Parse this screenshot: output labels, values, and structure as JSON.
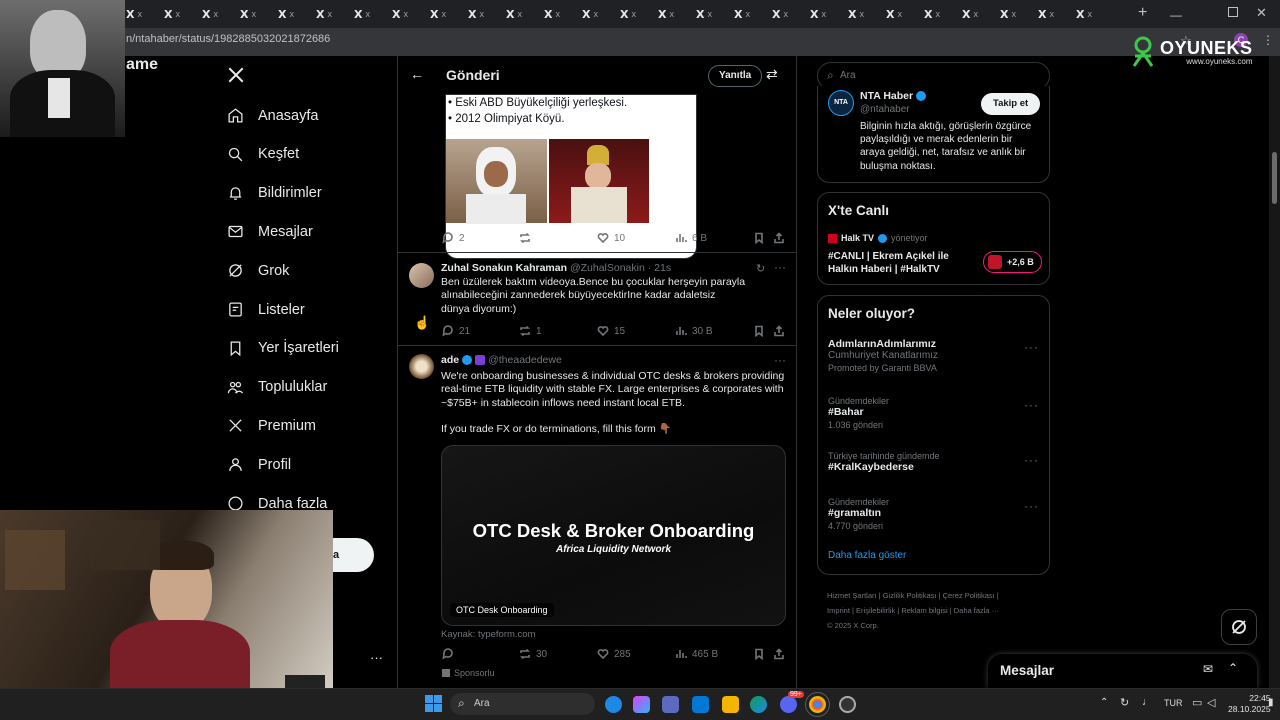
{
  "browser": {
    "tabs": [
      "X",
      "X",
      "X",
      "X",
      "X",
      "X",
      "X",
      "X",
      "X",
      "X",
      "X",
      "X",
      "X",
      "X",
      "X",
      "X",
      "X",
      "X",
      "X",
      "X",
      "X",
      "X",
      "X",
      "X",
      "X",
      "X"
    ],
    "tab_close": "x",
    "url": "n/ntahaber/status/1982885032021872686",
    "overlay_brand": "OYUNEKS",
    "overlay_sub": "www.oyuneks.com",
    "profile_initial": "C",
    "partial_text": "ame"
  },
  "nav": {
    "items": [
      {
        "label": "Anasayfa",
        "icon": "home-icon"
      },
      {
        "label": "Keşfet",
        "icon": "search-icon"
      },
      {
        "label": "Bildirimler",
        "icon": "bell-icon"
      },
      {
        "label": "Mesajlar",
        "icon": "mail-icon"
      },
      {
        "label": "Grok",
        "icon": "grok-icon"
      },
      {
        "label": "Listeler",
        "icon": "list-icon"
      },
      {
        "label": "Yer İşaretleri",
        "icon": "bookmark-icon"
      },
      {
        "label": "Topluluklar",
        "icon": "people-icon"
      },
      {
        "label": "Premium",
        "icon": "x-icon"
      },
      {
        "label": "Profil",
        "icon": "person-icon"
      },
      {
        "label": "Daha fazla",
        "icon": "more-icon"
      }
    ],
    "post_button_partial": "a",
    "more_dots": "···"
  },
  "header": {
    "title": "Gönderi",
    "reply_button": "Yanıtla"
  },
  "tweet1": {
    "lines": [
      "• Eski ABD Büyükelçiliği yerleşkesi.",
      "• 2012 Olimpiyat Köyü."
    ],
    "replies": "2",
    "retweets": "",
    "likes": "10",
    "views": "6 B"
  },
  "tweet2": {
    "name": "Zuhal Sonakın Kahraman",
    "handle": "@ZuhalSonakin · 21s",
    "text": "Ben üzülerek baktım videoya.Bence bu çocuklar herşeyin parayla alınabileceğini zannederek büyüyecektirIne kadar adaletsiz dünya diyorum:)",
    "replies": "21",
    "retweets": "1",
    "likes": "15",
    "views": "30 B"
  },
  "tweet3": {
    "name": "ade",
    "handle": "@theaadedewe",
    "text1": "We're onboarding businesses & individual OTC desks & brokers providing real-time ETB liquidity with stable FX. Large enterprises & corporates with ~$75B+ in stablecoin inflows need instant local ETB.",
    "text2": "If you trade FX or do terminations, fill this form 👇🏾",
    "card_title": "OTC Desk & Broker Onboarding",
    "card_sub": "Africa Liquidity Network",
    "card_label": "OTC Desk Onboarding",
    "source": "Kaynak: typeform.com",
    "replies": "",
    "retweets": "30",
    "likes": "285",
    "views": "465 B",
    "sponsored": "Sponsorlu"
  },
  "right": {
    "search_placeholder": "Ara",
    "profile": {
      "logo": "NTA",
      "name": "NTA Haber",
      "handle": "@ntahaber",
      "follow": "Takip et",
      "bio": "Bilginin hızla aktığı, görüşlerin özgürce paylaşıldığı ve merak edenlerin bir araya geldiği, net, tarafsız ve anlık bir buluşma noktası."
    },
    "live": {
      "title": "X'te Canlı",
      "channel": "Halk TV",
      "role": "yönetiyor",
      "stream": "#CANLI | Ekrem Açıkel ile Halkın Haberi | #HalkTV",
      "count": "+2,6 B"
    },
    "trends": {
      "title": "Neler oluyor?",
      "items": [
        {
          "ctx": "",
          "tag": "AdımlarınAdımlarımız",
          "sub": "Cumhuriyet Kanatlarımız",
          "meta": "Promoted by Garanti BBVA"
        },
        {
          "ctx": "Gündemdekiler",
          "tag": "#Bahar",
          "sub": "",
          "meta": "1.036 gönderi"
        },
        {
          "ctx": "Türkiye tarihinde gündemde",
          "tag": "#KralKaybederse",
          "sub": "",
          "meta": ""
        },
        {
          "ctx": "Gündemdekiler",
          "tag": "#gramaltın",
          "sub": "",
          "meta": "4.770 gönderi"
        }
      ],
      "show_more": "Daha fazla göster"
    },
    "footer": {
      "links": [
        "Hizmet Şartları",
        "Gizlilik Politikası",
        "Çerez Politikası",
        "Imprint",
        "Erişilebilirlik",
        "Reklam bilgisi",
        "Daha fazla ···"
      ],
      "copyright": "© 2025 X Corp."
    },
    "messages": "Mesajlar"
  },
  "taskbar": {
    "search": "Ara",
    "lang": "TUR",
    "time": "22:45",
    "date": "28.10.2025",
    "badge": "99+"
  },
  "colors": {
    "accent": "#1d9bf0",
    "verified": "#1d9bf0",
    "live_badge": "#f91880"
  }
}
